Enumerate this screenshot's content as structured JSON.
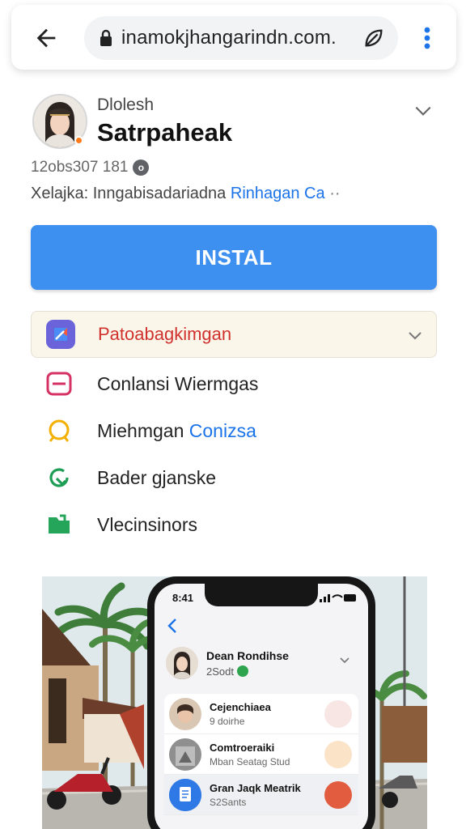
{
  "browser": {
    "url": "inamokjhangarindn.com."
  },
  "profile": {
    "subtitle": "Dlolesh",
    "title": "Satrpaheak",
    "meta_count": "12obs307 181",
    "meta_badge": "o",
    "meta_label": "Xelajka:",
    "meta_text": "Inngabisadariadna",
    "meta_link": "Rinhagan Ca",
    "meta_dots": "··"
  },
  "install": {
    "label": "INSTAL"
  },
  "menu": {
    "header_label": "Patoabagkimgan",
    "items": [
      {
        "label": "Conlansi Wiermgas",
        "extra": ""
      },
      {
        "label": "Miehmgan",
        "extra": "Conizsa"
      },
      {
        "label": "Bader gjanske",
        "extra": ""
      },
      {
        "label": "Vlecinsinors",
        "extra": ""
      }
    ]
  },
  "phone": {
    "time": "8:41",
    "header_name": "Dean Rondihse",
    "header_sub": "2Sodt",
    "list": [
      {
        "title": "Cejenchiaea",
        "sub": "9 doirhe"
      },
      {
        "title": "Comtroeraiki",
        "sub": "Mban Seatag Stud"
      },
      {
        "title": "Gran Jaqk Meatrik",
        "sub": "S2Sants"
      }
    ]
  },
  "colors": {
    "accent": "#3d8ff0",
    "link": "#1a73e8",
    "menu_header_text": "#d0312d",
    "menu_header_bg": "#fbf6ea"
  },
  "icons": [
    "arrow-back-icon",
    "lock-icon",
    "leaf-icon",
    "more-vert-icon",
    "chevron-down-icon",
    "share-icon",
    "card-icon",
    "ring-icon",
    "refresh-icon",
    "folder-icon"
  ]
}
